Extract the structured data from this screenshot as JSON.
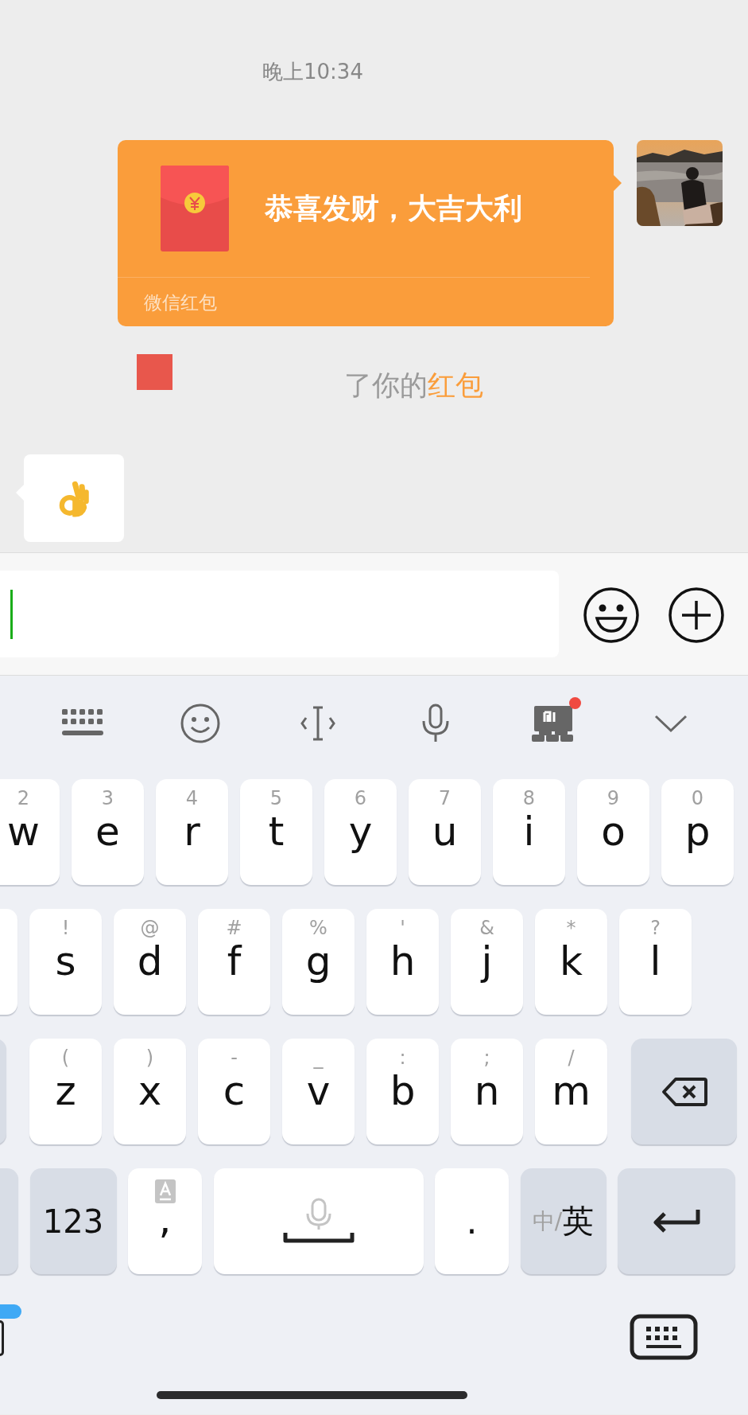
{
  "chat": {
    "timestamp": "晚上10:34",
    "messages": [
      {
        "kind": "red_packet",
        "title": "恭喜发财，大吉大利",
        "footer": "微信红包"
      },
      {
        "kind": "notice",
        "text": "了你的",
        "link": "红包"
      },
      {
        "kind": "emoji"
      }
    ]
  },
  "input": {
    "focused": true
  },
  "keyboard": {
    "toolbar": [
      {
        "kind": "keyboard"
      },
      {
        "kind": "emoji"
      },
      {
        "kind": "cursor"
      },
      {
        "kind": "voice"
      },
      {
        "kind": "store",
        "badge": true
      },
      {
        "kind": "collapse"
      }
    ],
    "rows": [
      [
        {
          "kind": "letter",
          "label": "w",
          "hint": "2"
        },
        {
          "kind": "letter",
          "label": "e",
          "hint": "3"
        },
        {
          "kind": "letter",
          "label": "r",
          "hint": "4"
        },
        {
          "kind": "letter",
          "label": "t",
          "hint": "5"
        },
        {
          "kind": "letter",
          "label": "y",
          "hint": "6"
        },
        {
          "kind": "letter",
          "label": "u",
          "hint": "7"
        },
        {
          "kind": "letter",
          "label": "i",
          "hint": "8"
        },
        {
          "kind": "letter",
          "label": "o",
          "hint": "9"
        },
        {
          "kind": "letter",
          "label": "p",
          "hint": "0"
        }
      ],
      [
        {
          "kind": "blank"
        },
        {
          "kind": "letter",
          "label": "s",
          "hint": "!"
        },
        {
          "kind": "letter",
          "label": "d",
          "hint": "@"
        },
        {
          "kind": "letter",
          "label": "f",
          "hint": "#"
        },
        {
          "kind": "letter",
          "label": "g",
          "hint": "%"
        },
        {
          "kind": "letter",
          "label": "h",
          "hint": "'"
        },
        {
          "kind": "letter",
          "label": "j",
          "hint": "&"
        },
        {
          "kind": "letter",
          "label": "k",
          "hint": "*"
        },
        {
          "kind": "letter",
          "label": "l",
          "hint": "?"
        }
      ],
      [
        {
          "kind": "shift"
        },
        {
          "kind": "letter",
          "label": "z",
          "hint": "("
        },
        {
          "kind": "letter",
          "label": "x",
          "hint": ")"
        },
        {
          "kind": "letter",
          "label": "c",
          "hint": "-"
        },
        {
          "kind": "letter",
          "label": "v",
          "hint": "_"
        },
        {
          "kind": "letter",
          "label": "b",
          "hint": ":"
        },
        {
          "kind": "letter",
          "label": "n",
          "hint": ";"
        },
        {
          "kind": "letter",
          "label": "m",
          "hint": "/"
        },
        {
          "kind": "delete"
        }
      ]
    ],
    "bottom_row": [
      {
        "kind": "symbols"
      },
      {
        "kind": "numbers",
        "label": "123"
      },
      {
        "kind": "comma",
        "label": ","
      },
      {
        "kind": "space"
      },
      {
        "kind": "punct",
        "label": "."
      },
      {
        "kind": "lang",
        "inactive": "中/",
        "active": "英"
      },
      {
        "kind": "enter"
      }
    ]
  }
}
